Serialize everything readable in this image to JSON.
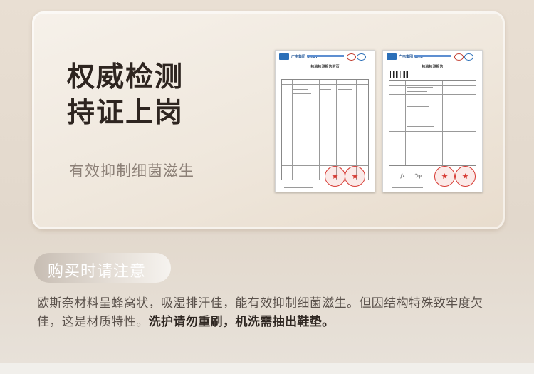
{
  "card": {
    "headline_line1": "权威检测",
    "headline_line2": "持证上岗",
    "subline": "有效抑制细菌滋生",
    "reports": [
      {
        "title": "检验检测报告附页",
        "logo_text": "广电集团 GRGT"
      },
      {
        "title": "检验检测报告",
        "logo_text": "广电集团 GRGT"
      }
    ]
  },
  "notice": {
    "tag_label": "购买时请注意",
    "body_plain": "欧斯奈材料呈蜂窝状，吸湿排汗佳，能有效抑制细菌滋生。但因结构特殊致牢度欠佳，这是材质特性。",
    "body_bold": "洗护请勿重刷，机洗需抽出鞋垫。"
  },
  "colors": {
    "headline": "#2e2520",
    "subline": "#8c8077",
    "stamp_red": "#d73a33",
    "logo_blue": "#2b6fb8"
  }
}
